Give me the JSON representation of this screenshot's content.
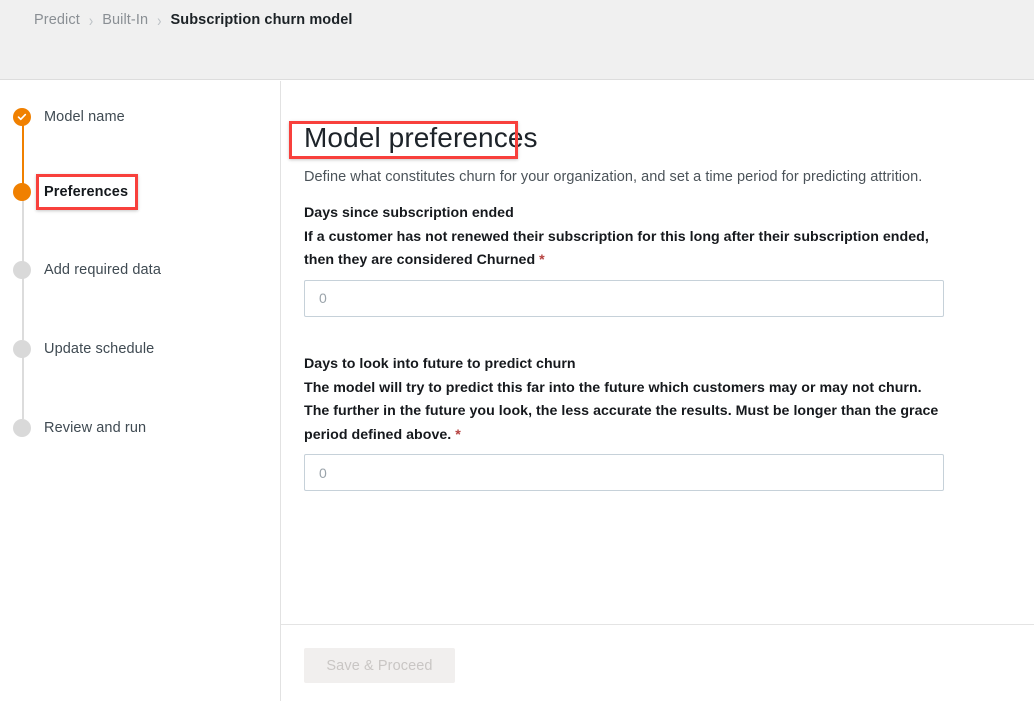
{
  "breadcrumb": {
    "items": [
      {
        "label": "Predict",
        "current": false
      },
      {
        "label": "Built-In",
        "current": false
      },
      {
        "label": "Subscription churn model",
        "current": true
      }
    ],
    "separator": "›"
  },
  "sidebar": {
    "steps": [
      {
        "label": "Model name",
        "state": "done"
      },
      {
        "label": "Preferences",
        "state": "current"
      },
      {
        "label": "Add required data",
        "state": "todo"
      },
      {
        "label": "Update schedule",
        "state": "todo"
      },
      {
        "label": "Review and run",
        "state": "todo"
      }
    ]
  },
  "main": {
    "title": "Model preferences",
    "subtitle": "Define what constitutes churn for your organization, and set a time period for predicting attrition.",
    "fields": [
      {
        "title": "Days since subscription ended",
        "description": "If a customer has not renewed their subscription for this long after their subscription ended, then they are considered Churned",
        "required_marker": "*",
        "value": "",
        "placeholder": "0"
      },
      {
        "title": "Days to look into future to predict churn",
        "description": "The model will try to predict this far into the future which customers may or may not churn. The further in the future you look, the less accurate the results. Must be longer than the grace period defined above.",
        "required_marker": "*",
        "value": "",
        "placeholder": "0"
      }
    ]
  },
  "footer": {
    "save_label": "Save & Proceed",
    "save_disabled": true
  },
  "colors": {
    "accent_orange": "#f08000",
    "annotation_red": "#f8403c",
    "required_red": "#b5413f",
    "header_background": "#f0f0f0",
    "step_inactive": "#d9d9d9"
  }
}
